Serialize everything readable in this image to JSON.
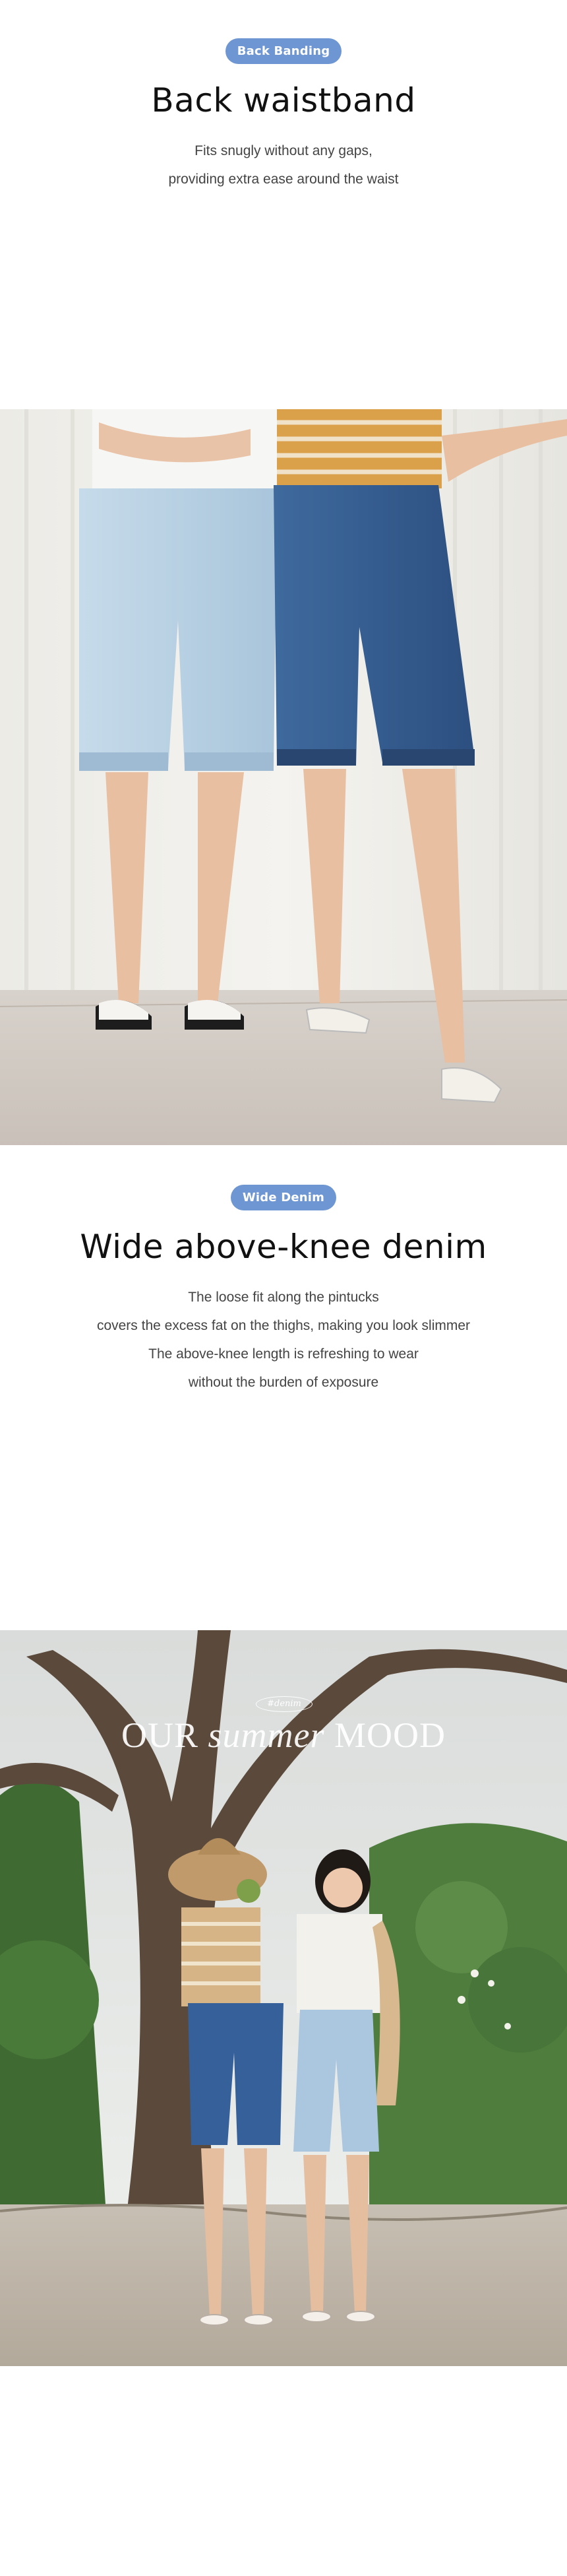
{
  "section1": {
    "badge": "Back Banding",
    "title": "Back waistband",
    "lines": [
      "Fits snugly without any gaps,",
      "providing extra ease around the waist"
    ]
  },
  "section2": {
    "badge": "Wide Denim",
    "title": "Wide above-knee denim",
    "lines": [
      "The loose fit along the pintucks",
      "covers the excess fat on the thighs, making you look slimmer",
      "The above-knee length is refreshing to wear",
      "without the burden of exposure"
    ]
  },
  "photo3": {
    "badge_small": "#denim",
    "overlay": {
      "part1": "OUR ",
      "part2": "summer",
      "part3": " MOOD"
    }
  }
}
